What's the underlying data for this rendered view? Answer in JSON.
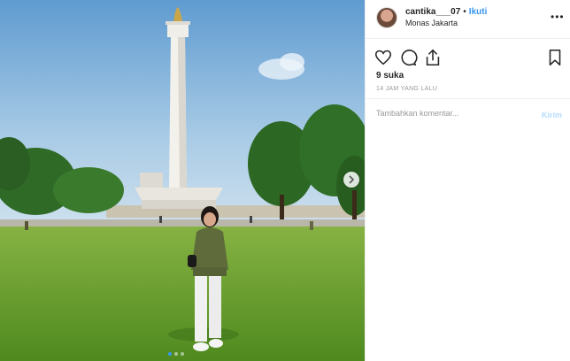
{
  "post": {
    "username": "cantika___07",
    "separator": "•",
    "follow_label": "Ikuti",
    "location": "Monas Jakarta",
    "more_label": "•••",
    "likes": "9 suka",
    "timestamp": "14 JAM YANG LALU",
    "comment_placeholder": "Tambahkan komentar...",
    "post_label": "Kirim"
  },
  "icons": {
    "like": "heart-icon",
    "comment": "comment-icon",
    "share": "share-icon",
    "save": "bookmark-icon",
    "next": "chevron-right-icon"
  },
  "colors": {
    "link": "#3897f0",
    "post_disabled": "#b3dbff",
    "text": "#262626",
    "muted": "#999999"
  }
}
